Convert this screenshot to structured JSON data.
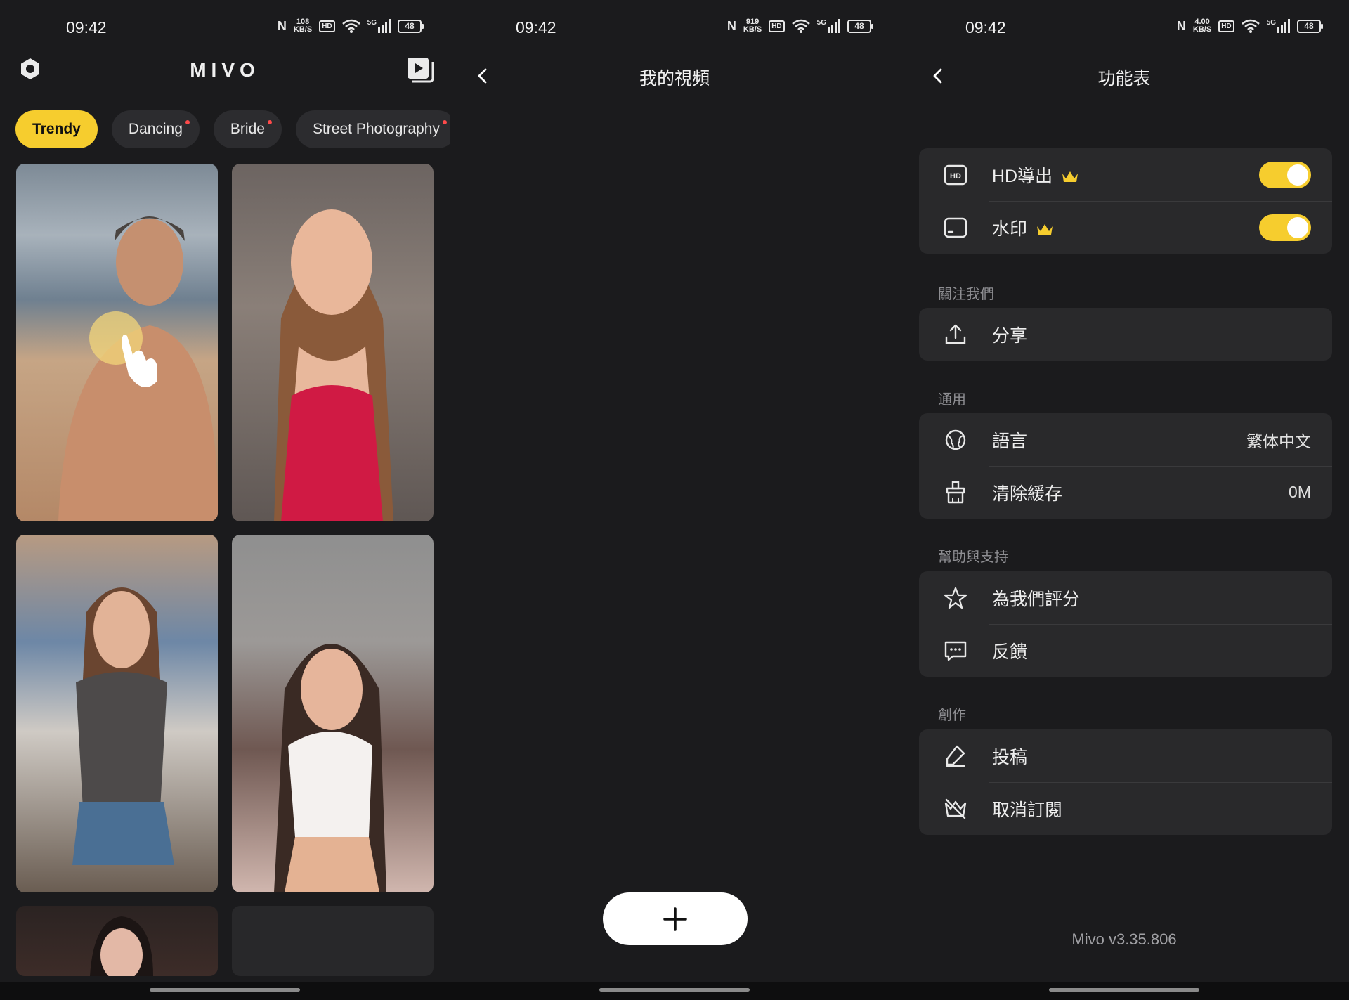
{
  "status_bar": {
    "time": "09:42",
    "panels": [
      {
        "speed_top": "108",
        "speed_unit": "KB/S",
        "signal": "5G",
        "battery": "48"
      },
      {
        "speed_top": "919",
        "speed_unit": "KB/S",
        "signal": "5G",
        "battery": "48"
      },
      {
        "speed_top": "4.00",
        "speed_unit": "KB/S",
        "signal": "5G",
        "battery": "48"
      }
    ],
    "nfc": "N",
    "hd": "HD"
  },
  "home": {
    "app_title": "MIVO",
    "categories": [
      "Trendy",
      "Dancing",
      "Bride",
      "Street Photography"
    ],
    "active_category": "Trendy"
  },
  "my_videos": {
    "title": "我的視頻",
    "add_label": "+"
  },
  "settings": {
    "title": "功能表",
    "hd_export": "HD導出",
    "watermark": "水印",
    "section_follow": "關注我們",
    "share": "分享",
    "section_general": "通用",
    "language": "語言",
    "language_value": "繁体中文",
    "clear_cache": "清除緩存",
    "cache_value": "0M",
    "section_help": "幫助與支持",
    "rate_us": "為我們評分",
    "feedback": "反饋",
    "section_create": "創作",
    "submit": "投稿",
    "unsubscribe": "取消訂閱",
    "version": "Mivo v3.35.806",
    "hd_icon_text": "HD"
  },
  "colors": {
    "accent": "#f6cd2e",
    "background": "#1b1b1d",
    "card": "#29292b"
  }
}
